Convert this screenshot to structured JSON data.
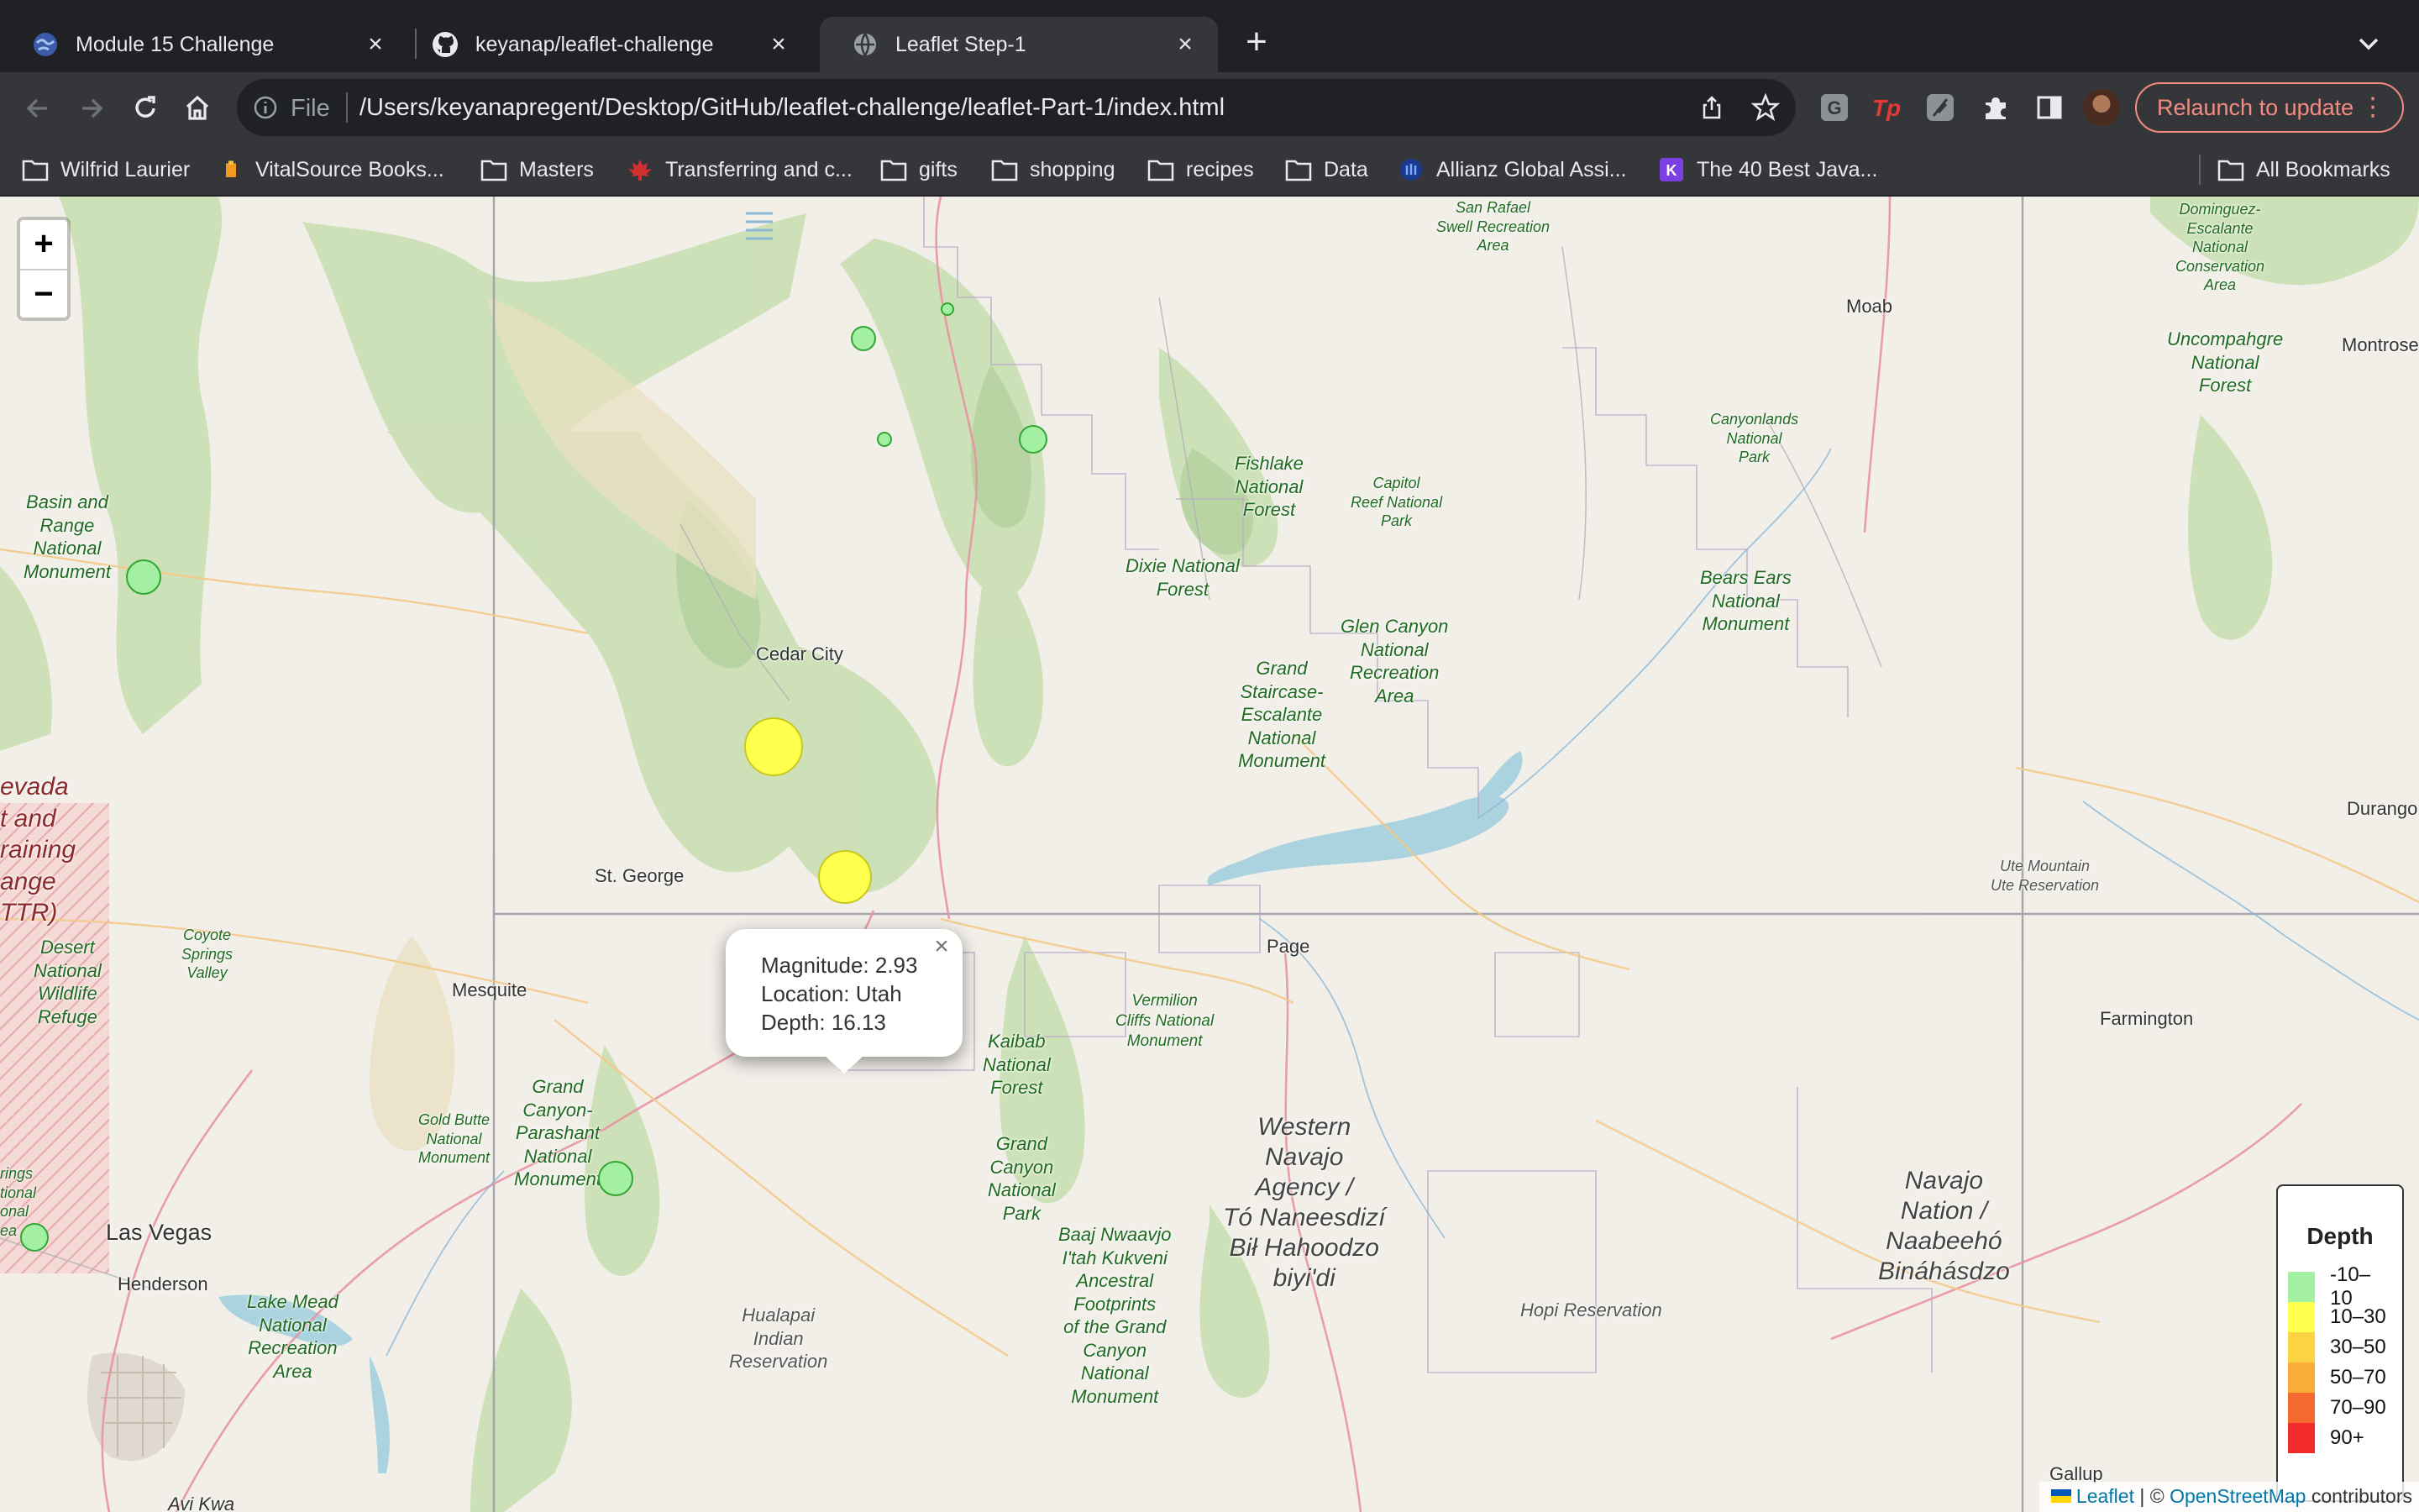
{
  "tabs": [
    {
      "title": "Module 15 Challenge",
      "favicon": "earth-favicon-icon",
      "active": false
    },
    {
      "title": "keyanap/leaflet-challenge",
      "favicon": "github-icon",
      "active": false
    },
    {
      "title": "Leaflet Step-1",
      "favicon": "globe-icon",
      "active": true
    }
  ],
  "toolbar": {
    "scheme_label": "File",
    "url": "/Users/keyanapregent/Desktop/GitHub/leaflet-challenge/leaflet-Part-1/index.html",
    "relaunch_label": "Relaunch to update",
    "extensions": [
      "grammarly-icon",
      "tp-extension-icon",
      "feather-extension-icon",
      "puzzle-extensions-icon",
      "side-panel-icon"
    ]
  },
  "bookmarks": [
    {
      "label": "Wilfrid Laurier",
      "icon": "folder-icon"
    },
    {
      "label": "VitalSource Books...",
      "icon": "vitalsource-icon"
    },
    {
      "label": "Masters",
      "icon": "folder-icon"
    },
    {
      "label": "Transferring and c...",
      "icon": "maple-leaf-icon"
    },
    {
      "label": "gifts",
      "icon": "folder-icon"
    },
    {
      "label": "shopping",
      "icon": "folder-icon"
    },
    {
      "label": "recipes",
      "icon": "folder-icon"
    },
    {
      "label": "Data",
      "icon": "folder-icon"
    },
    {
      "label": "Allianz Global Assi...",
      "icon": "allianz-icon"
    },
    {
      "label": "The 40 Best Java...",
      "icon": "k-logo-icon"
    },
    {
      "label": "All Bookmarks",
      "icon": "folder-icon"
    }
  ],
  "map": {
    "zoom_in": "+",
    "zoom_out": "−",
    "places": {
      "moab": "Moab",
      "montrose": "Montrose",
      "cedar_city": "Cedar City",
      "st_george": "St. George",
      "mesquite": "Mesquite",
      "page": "Page",
      "las_vegas": "Las Vegas",
      "henderson": "Henderson",
      "farmington": "Farmington",
      "durango": "Durango",
      "gallup": "Gallup",
      "avi_kwa": "Avi Kwa",
      "basin_range": "Basin and\nRange\nNational\nMonument",
      "san_rafael": "San Rafael\nSwell Recreation\nArea",
      "fishlake": "Fishlake\nNational\nForest",
      "capitol_reef": "Capitol\nReef National\nPark",
      "dixie": "Dixie National\nForest",
      "glen_canyon": "Glen Canyon\nNational\nRecreation\nArea",
      "gsenm": "Grand\nStaircase-\nEscalante\nNational\nMonument",
      "canyonlands": "Canyonlands\nNational\nPark",
      "bears_ears": "Bears Ears\nNational\nMonument",
      "uncompahgre": "Uncompahgre\nNational\nForest",
      "dominguez": "Dominguez-\nEscalante\nNational\nConservation\nArea",
      "nevada_range": "evada\nt and\nraining\nange\nTTR)",
      "desert_nwr": "Desert\nNational\nWildlife\nRefuge",
      "coyote": "Coyote\nSprings\nValley",
      "vermilion": "Vermilion\nCliffs National\nMonument",
      "kaibab": "Kaibab\nNational\nForest",
      "grand_canyon_parashant": "Grand\nCanyon-\nParashant\nNational\nMonument",
      "gold_butte": "Gold Butte\nNational\nMonument",
      "grand_canyon_np": "Grand\nCanyon\nNational\nPark",
      "baaj": "Baaj Nwaavjo\nI'tah Kukveni\nAncestral\nFootprints\nof the Grand\nCanyon\nNational\nMonument",
      "lake_mead": "Lake Mead\nNational\nRecreation\nArea",
      "hualapai": "Hualapai\nIndian\nReservation",
      "western_navajo": "Western\nNavajo\nAgency /\nTó Naneesdizí\nBił Hahoodzo\nbiyi'di",
      "hopi": "Hopi Reservation",
      "navajo_nation": "Navajo\nNation /\nNaabeehó\nBináhásdzo",
      "ute_mountain": "Ute Mountain\nUte Reservation",
      "spring_mtns": "rings\ntional\nonal\nea"
    },
    "popup": {
      "magnitude": "Magnitude: 2.93",
      "location": "Location: Utah",
      "depth": "Depth: 16.13",
      "close": "×"
    },
    "legend": {
      "title": "Depth",
      "rows": [
        {
          "label": "-10–10",
          "color": "#a3f0a3"
        },
        {
          "label": "10–30",
          "color": "#ffff4d"
        },
        {
          "label": "30–50",
          "color": "#fcd443"
        },
        {
          "label": "50–70",
          "color": "#fbad3a"
        },
        {
          "label": "70–90",
          "color": "#f4692f"
        },
        {
          "label": "90+",
          "color": "#f22c2c"
        }
      ]
    },
    "attribution": {
      "leaflet": "Leaflet",
      "sep": " | © ",
      "osm": "OpenStreetMap",
      "contributors": " contributors"
    }
  }
}
